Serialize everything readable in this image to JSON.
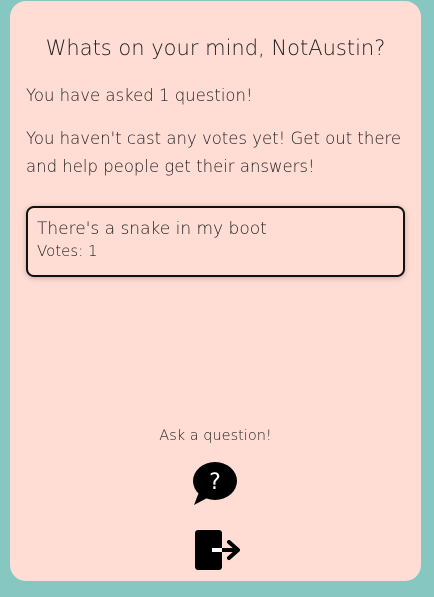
{
  "header": {
    "title": "Whats on your mind, NotAustin?"
  },
  "stats": {
    "questions_asked": "You have asked 1 question!",
    "votes_cast": "You haven't cast any votes yet! Get out there and help people get their answers!"
  },
  "questions": [
    {
      "text": "There's a snake in my boot",
      "votes_label": "Votes: 1"
    }
  ],
  "actions": {
    "ask_label": "Ask a question!",
    "ask_icon": "question-speech-bubble-icon",
    "logout_icon": "sign-out-icon"
  },
  "colors": {
    "background": "#86c7c1",
    "card": "#ffddd4",
    "text": "#1e1e1e"
  }
}
